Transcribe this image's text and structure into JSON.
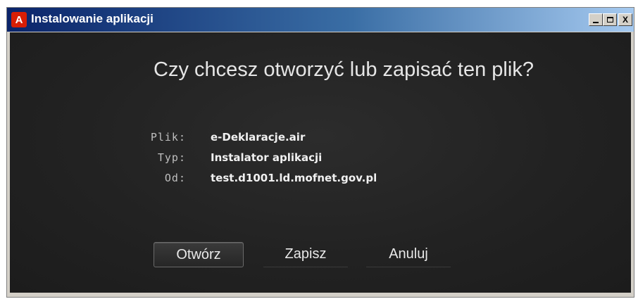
{
  "window": {
    "title": "Instalowanie aplikacji",
    "app_icon": "adobe-air-icon",
    "controls": {
      "minimize": "minimize-icon",
      "maximize": "maximize-icon",
      "close_glyph": "X"
    }
  },
  "dialog": {
    "headline": "Czy chcesz otworzyć lub zapisać ten plik?",
    "file_label": "Plik:",
    "file_value": "e-Deklaracje.air",
    "type_label": "Typ:",
    "type_value": "Instalator aplikacji",
    "from_label": "Od:",
    "from_value": "test.d1001.ld.mofnet.gov.pl"
  },
  "buttons": {
    "open": "Otwórz",
    "save": "Zapisz",
    "cancel": "Anuluj"
  },
  "colors": {
    "titlebar_start": "#0a246a",
    "titlebar_end": "#a6caf0",
    "panel_bg": "#222222",
    "accent_icon": "#d81e05"
  }
}
